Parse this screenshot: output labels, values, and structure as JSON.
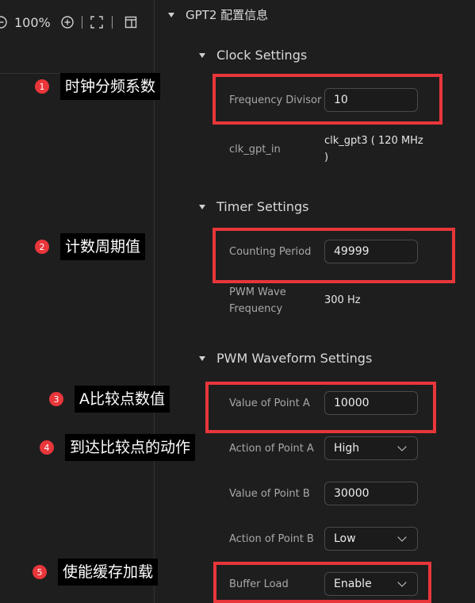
{
  "toolbar": {
    "zoom": "100%"
  },
  "panel": {
    "title": "GPT2 配置信息"
  },
  "sections": {
    "clock": {
      "title": "Clock Settings",
      "freq_label": "Frequency Divisor",
      "freq_value": "10",
      "clk_label": "clk_gpt_in",
      "clk_value_1": "clk_gpt3 ( 120 MHz",
      "clk_value_2": ")"
    },
    "timer": {
      "title": "Timer Settings",
      "period_label": "Counting Period",
      "period_value": "49999",
      "pwm_label_1": "PWM Wave",
      "pwm_label_2": "Frequency",
      "pwm_value": "300 Hz"
    },
    "pwm": {
      "title": "PWM Waveform Settings",
      "a_value_label": "Value of Point A",
      "a_value": "10000",
      "a_action_label": "Action of Point A",
      "a_action": "High",
      "b_value_label": "Value of Point B",
      "b_value": "30000",
      "b_action_label": "Action of Point B",
      "b_action": "Low",
      "buffer_label": "Buffer Load",
      "buffer_value": "Enable"
    }
  },
  "annotations": [
    {
      "num": "1",
      "text": "时钟分频系数"
    },
    {
      "num": "2",
      "text": "计数周期值"
    },
    {
      "num": "3",
      "text": "A比较点数值"
    },
    {
      "num": "4",
      "text": "到达比较点的动作"
    },
    {
      "num": "5",
      "text": "使能缓存加载"
    }
  ],
  "colors": {
    "highlight": "#e8363a",
    "background": "#1e1e1f"
  }
}
